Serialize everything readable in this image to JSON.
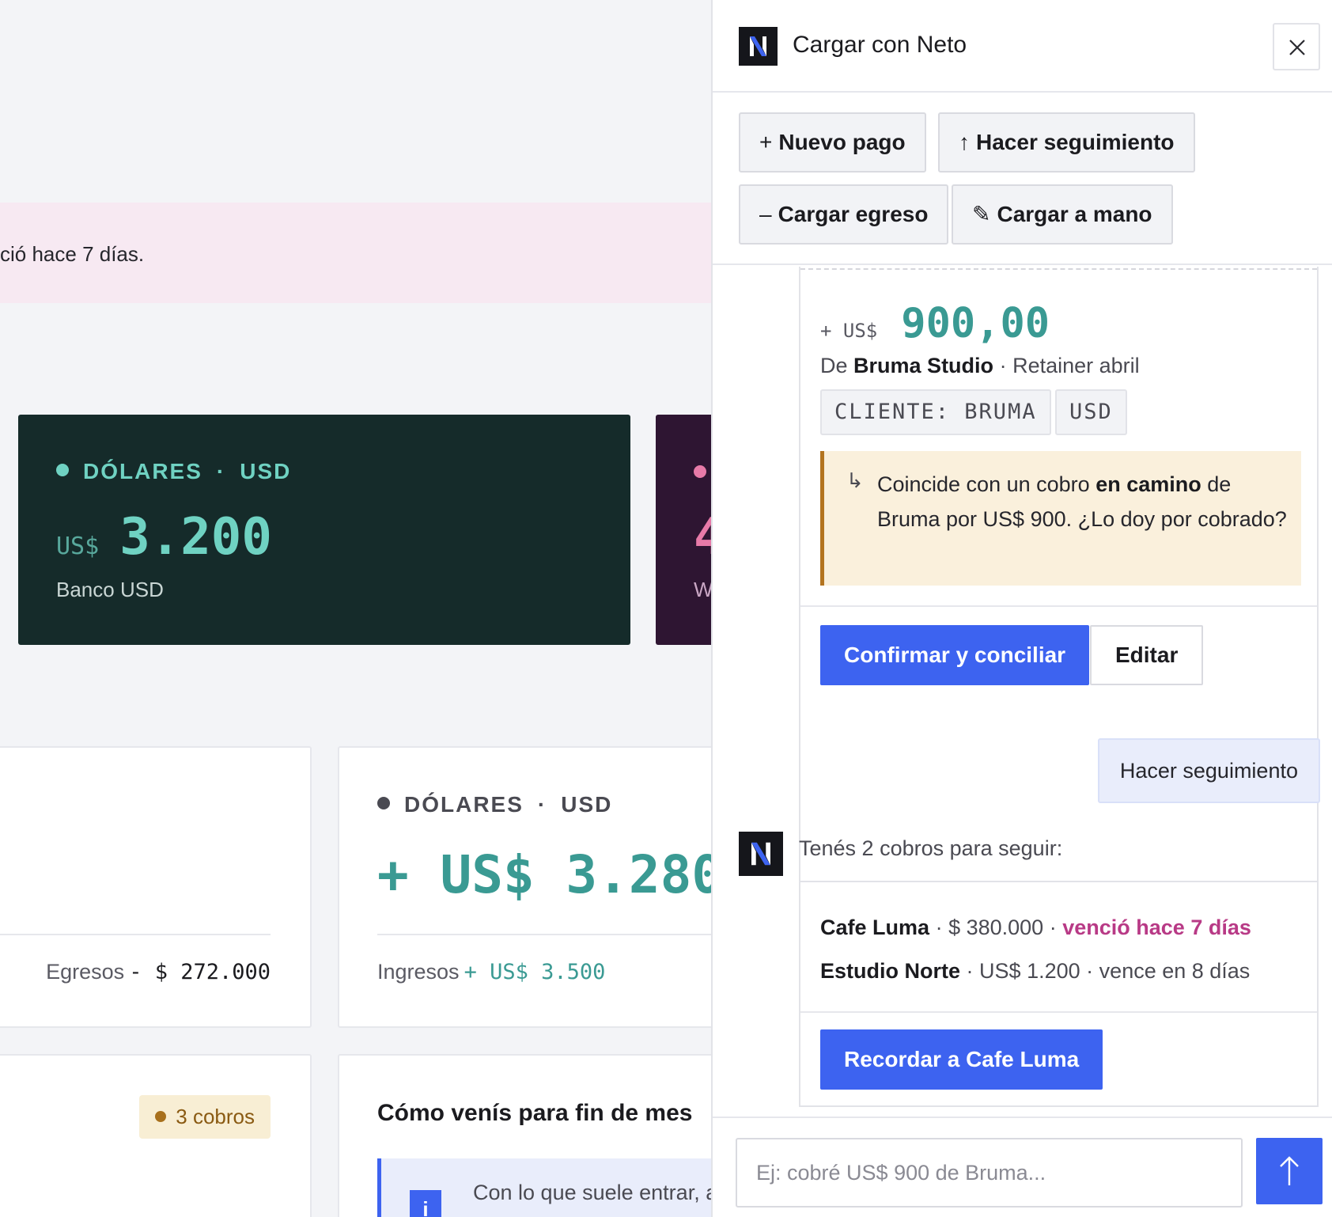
{
  "dashboard": {
    "alert_text": "ció hace 7 días.",
    "account_usd": {
      "label": "DÓLARES",
      "code": "USD",
      "currency": "US$",
      "balance": "3.200",
      "bank": "Banco USD"
    },
    "account_other": {
      "balance_partial": "4",
      "bank_partial": "W"
    },
    "summary_left": {
      "label": "Egresos",
      "value": "- $ 272.000"
    },
    "summary_right": {
      "label": "DÓLARES",
      "code": "USD",
      "total": "+ US$ 3.280",
      "row_label": "Ingresos",
      "row_value": "+ US$ 3.500"
    },
    "cobros_badge": "3 cobros",
    "forecast": {
      "title": "Cómo venís para fin de mes",
      "info_text": "Con lo que suele entrar, a",
      "info_icon": "i"
    }
  },
  "panel": {
    "title": "Cargar con Neto",
    "logo_letter": "N",
    "actions": [
      {
        "glyph": "+",
        "label": "Nuevo pago"
      },
      {
        "glyph": "↑",
        "label": "Hacer seguimiento"
      },
      {
        "glyph": "–",
        "label": "Cargar egreso"
      },
      {
        "glyph": "✎",
        "label": "Cargar a mano"
      }
    ],
    "transaction": {
      "sign": "+",
      "currency": "US$",
      "amount": "900,00",
      "from_prefix": "De",
      "from_name": "Bruma Studio",
      "from_sep": "·",
      "concept": "Retainer abril",
      "tags": [
        "CLIENTE: BRUMA",
        "USD"
      ],
      "match_arrow": "↳",
      "match_text_1": "Coincide con un cobro",
      "match_bold": "en camino",
      "match_text_2": "de Bruma por US$ 900. ¿Lo doy por cobrado?",
      "confirm_label": "Confirmar y conciliar",
      "edit_label": "Editar"
    },
    "user_message": "Hacer seguimiento",
    "bot_message": "Tenés 2 cobros para seguir:",
    "cobros": [
      {
        "name": "Cafe Luma",
        "amount": "$ 380.000",
        "status": "venció hace 7 días",
        "overdue": true
      },
      {
        "name": "Estudio Norte",
        "amount": "US$ 1.200",
        "status": "vence en 8 días",
        "overdue": false
      }
    ],
    "sep": "·",
    "remind_label": "Recordar a Cafe Luma",
    "composer": {
      "placeholder": "Ej: cobré US$ 900 de Bruma...",
      "value": ""
    }
  },
  "colors": {
    "accent": "#3d63f0",
    "teal": "#3a9a93",
    "overdue": "#b83a86",
    "account_bg": "#152b2a"
  }
}
